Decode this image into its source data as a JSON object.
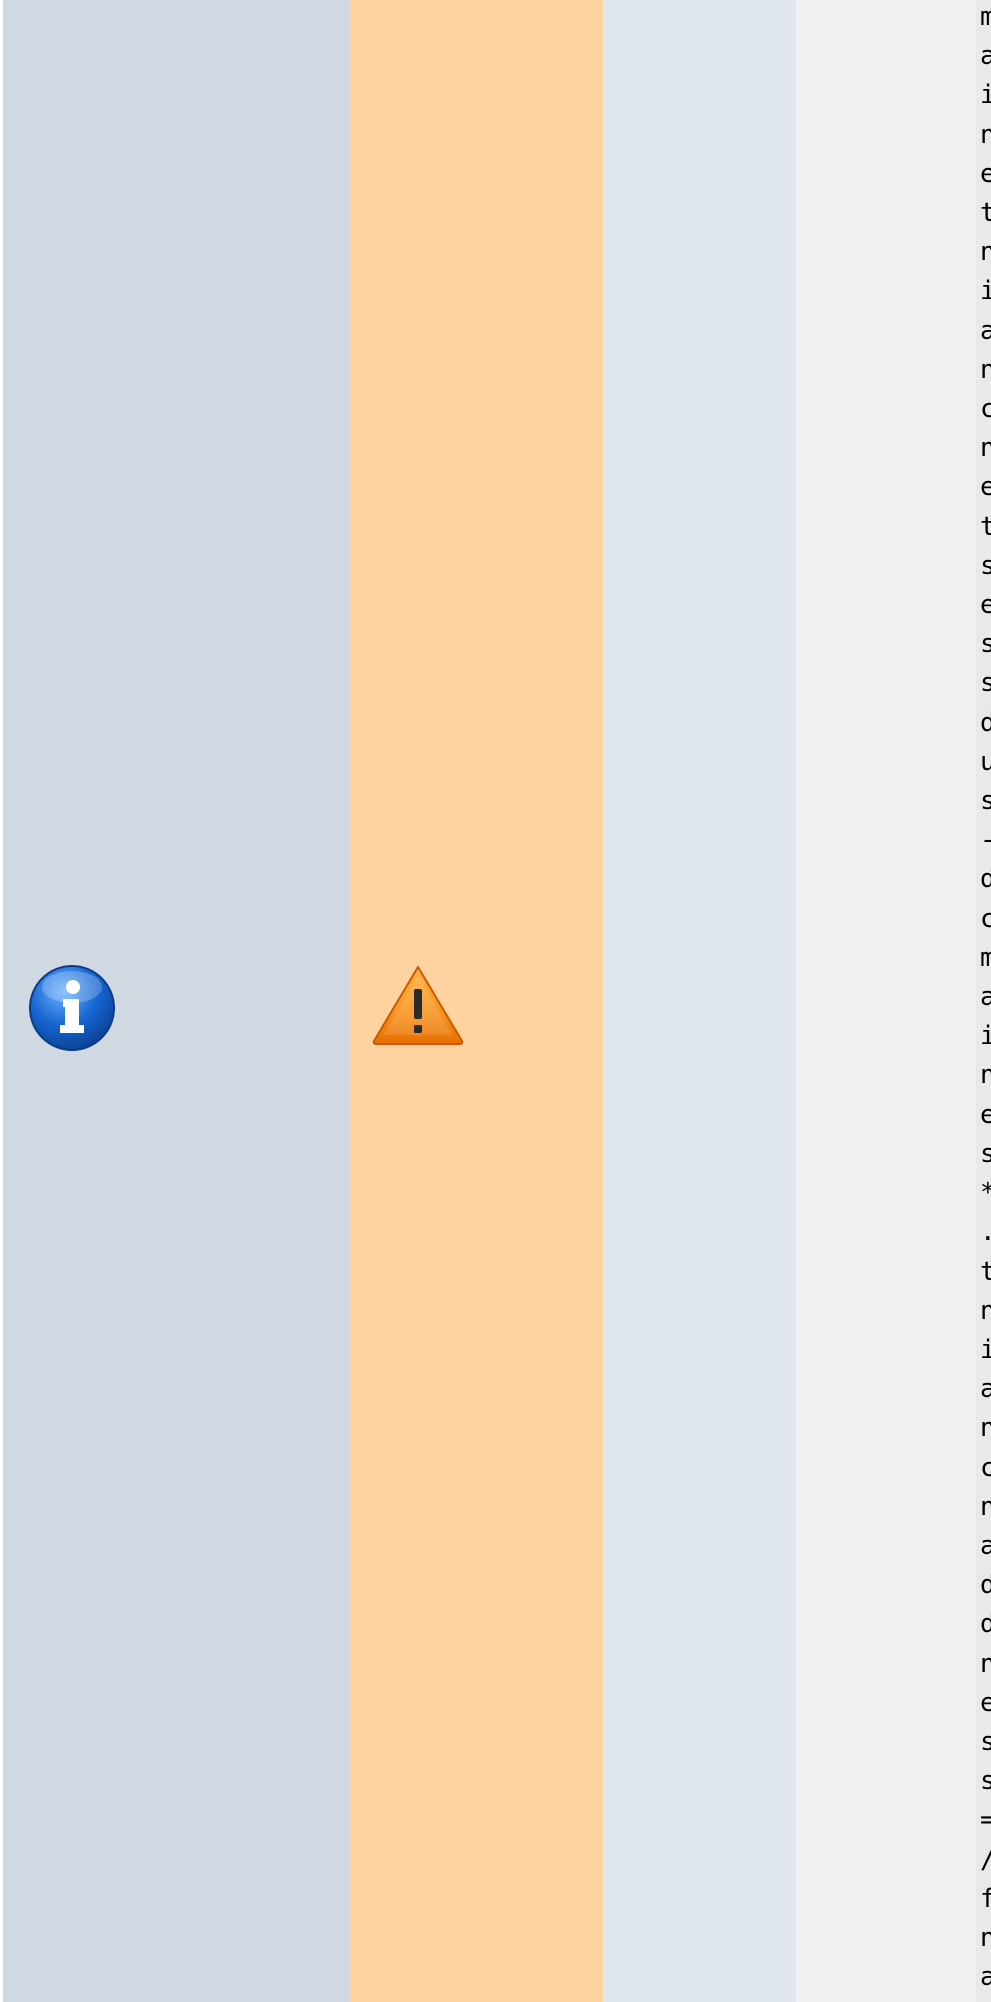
{
  "panels": {
    "info": {
      "icon": "info-icon",
      "color": "#d0d8e1"
    },
    "warning": {
      "icon": "warning-icon",
      "color": "#fed39f"
    },
    "light": {
      "color": "#dfe6ee"
    },
    "gray": {
      "color": "#f0f0f0"
    }
  },
  "code": {
    "text": "m\na\ni\nn\ne\nt\nn\ni\na\nn\nc\nn\ne\nt\ns\ne\ns\ns\nd\nu\ns\n-\nd\nc\nm\na\ni\nn\ne\ns\n*\n.\nt\nn\ni\na\nn\nc\nn\na\nd\nd\nn\ne\ns\ns\n=\n/\nf\nn\na"
  }
}
